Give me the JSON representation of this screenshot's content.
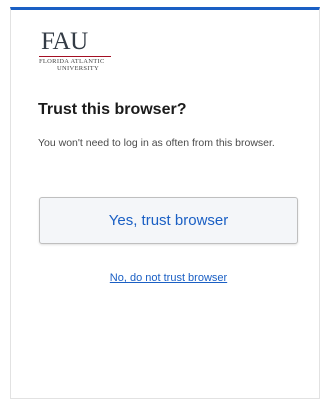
{
  "logo": {
    "main": "FAU",
    "line1": "FLORIDA ATLANTIC",
    "line2": "UNIVERSITY"
  },
  "dialog": {
    "title": "Trust this browser?",
    "description": "You won't need to log in as often from this browser.",
    "primary_button": "Yes, trust browser",
    "secondary_link": "No, do not trust browser"
  },
  "colors": {
    "accent": "#1a5fc4",
    "logo_rule": "#a30f23"
  }
}
